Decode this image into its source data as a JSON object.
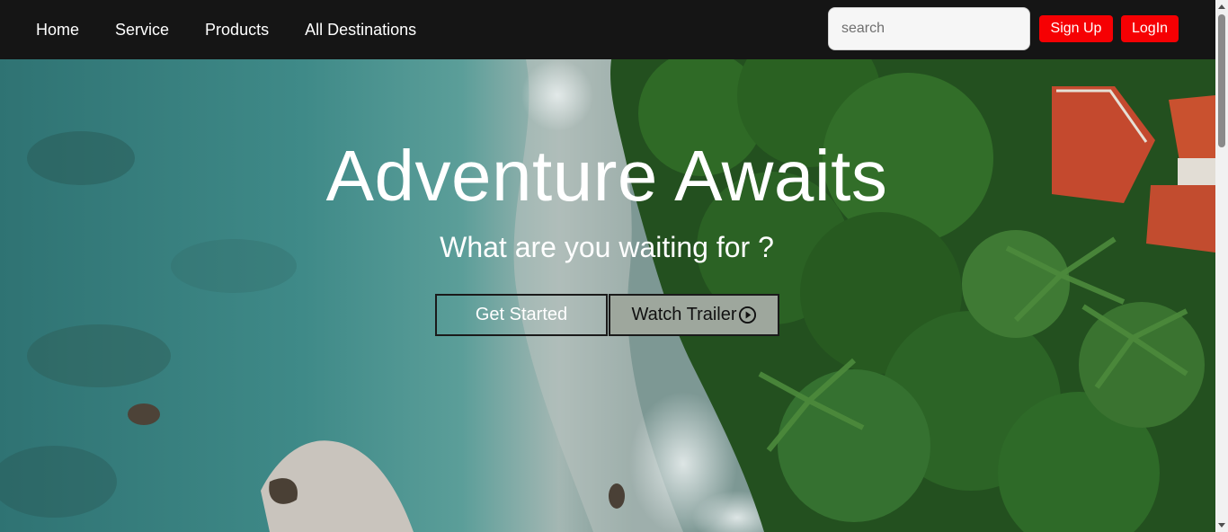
{
  "nav": {
    "links": [
      "Home",
      "Service",
      "Products",
      "All Destinations"
    ],
    "search_placeholder": "search",
    "signup_label": "Sign Up",
    "login_label": "LogIn",
    "accent_color": "#f60003",
    "background_color": "#151515"
  },
  "hero": {
    "title": "Adventure Awaits",
    "subtitle": "What are you waiting for ?",
    "get_started_label": "Get Started",
    "watch_trailer_label": "Watch Trailer",
    "watch_trailer_icon": "play-circle-icon",
    "background_image": "aerial-coast-photo"
  }
}
